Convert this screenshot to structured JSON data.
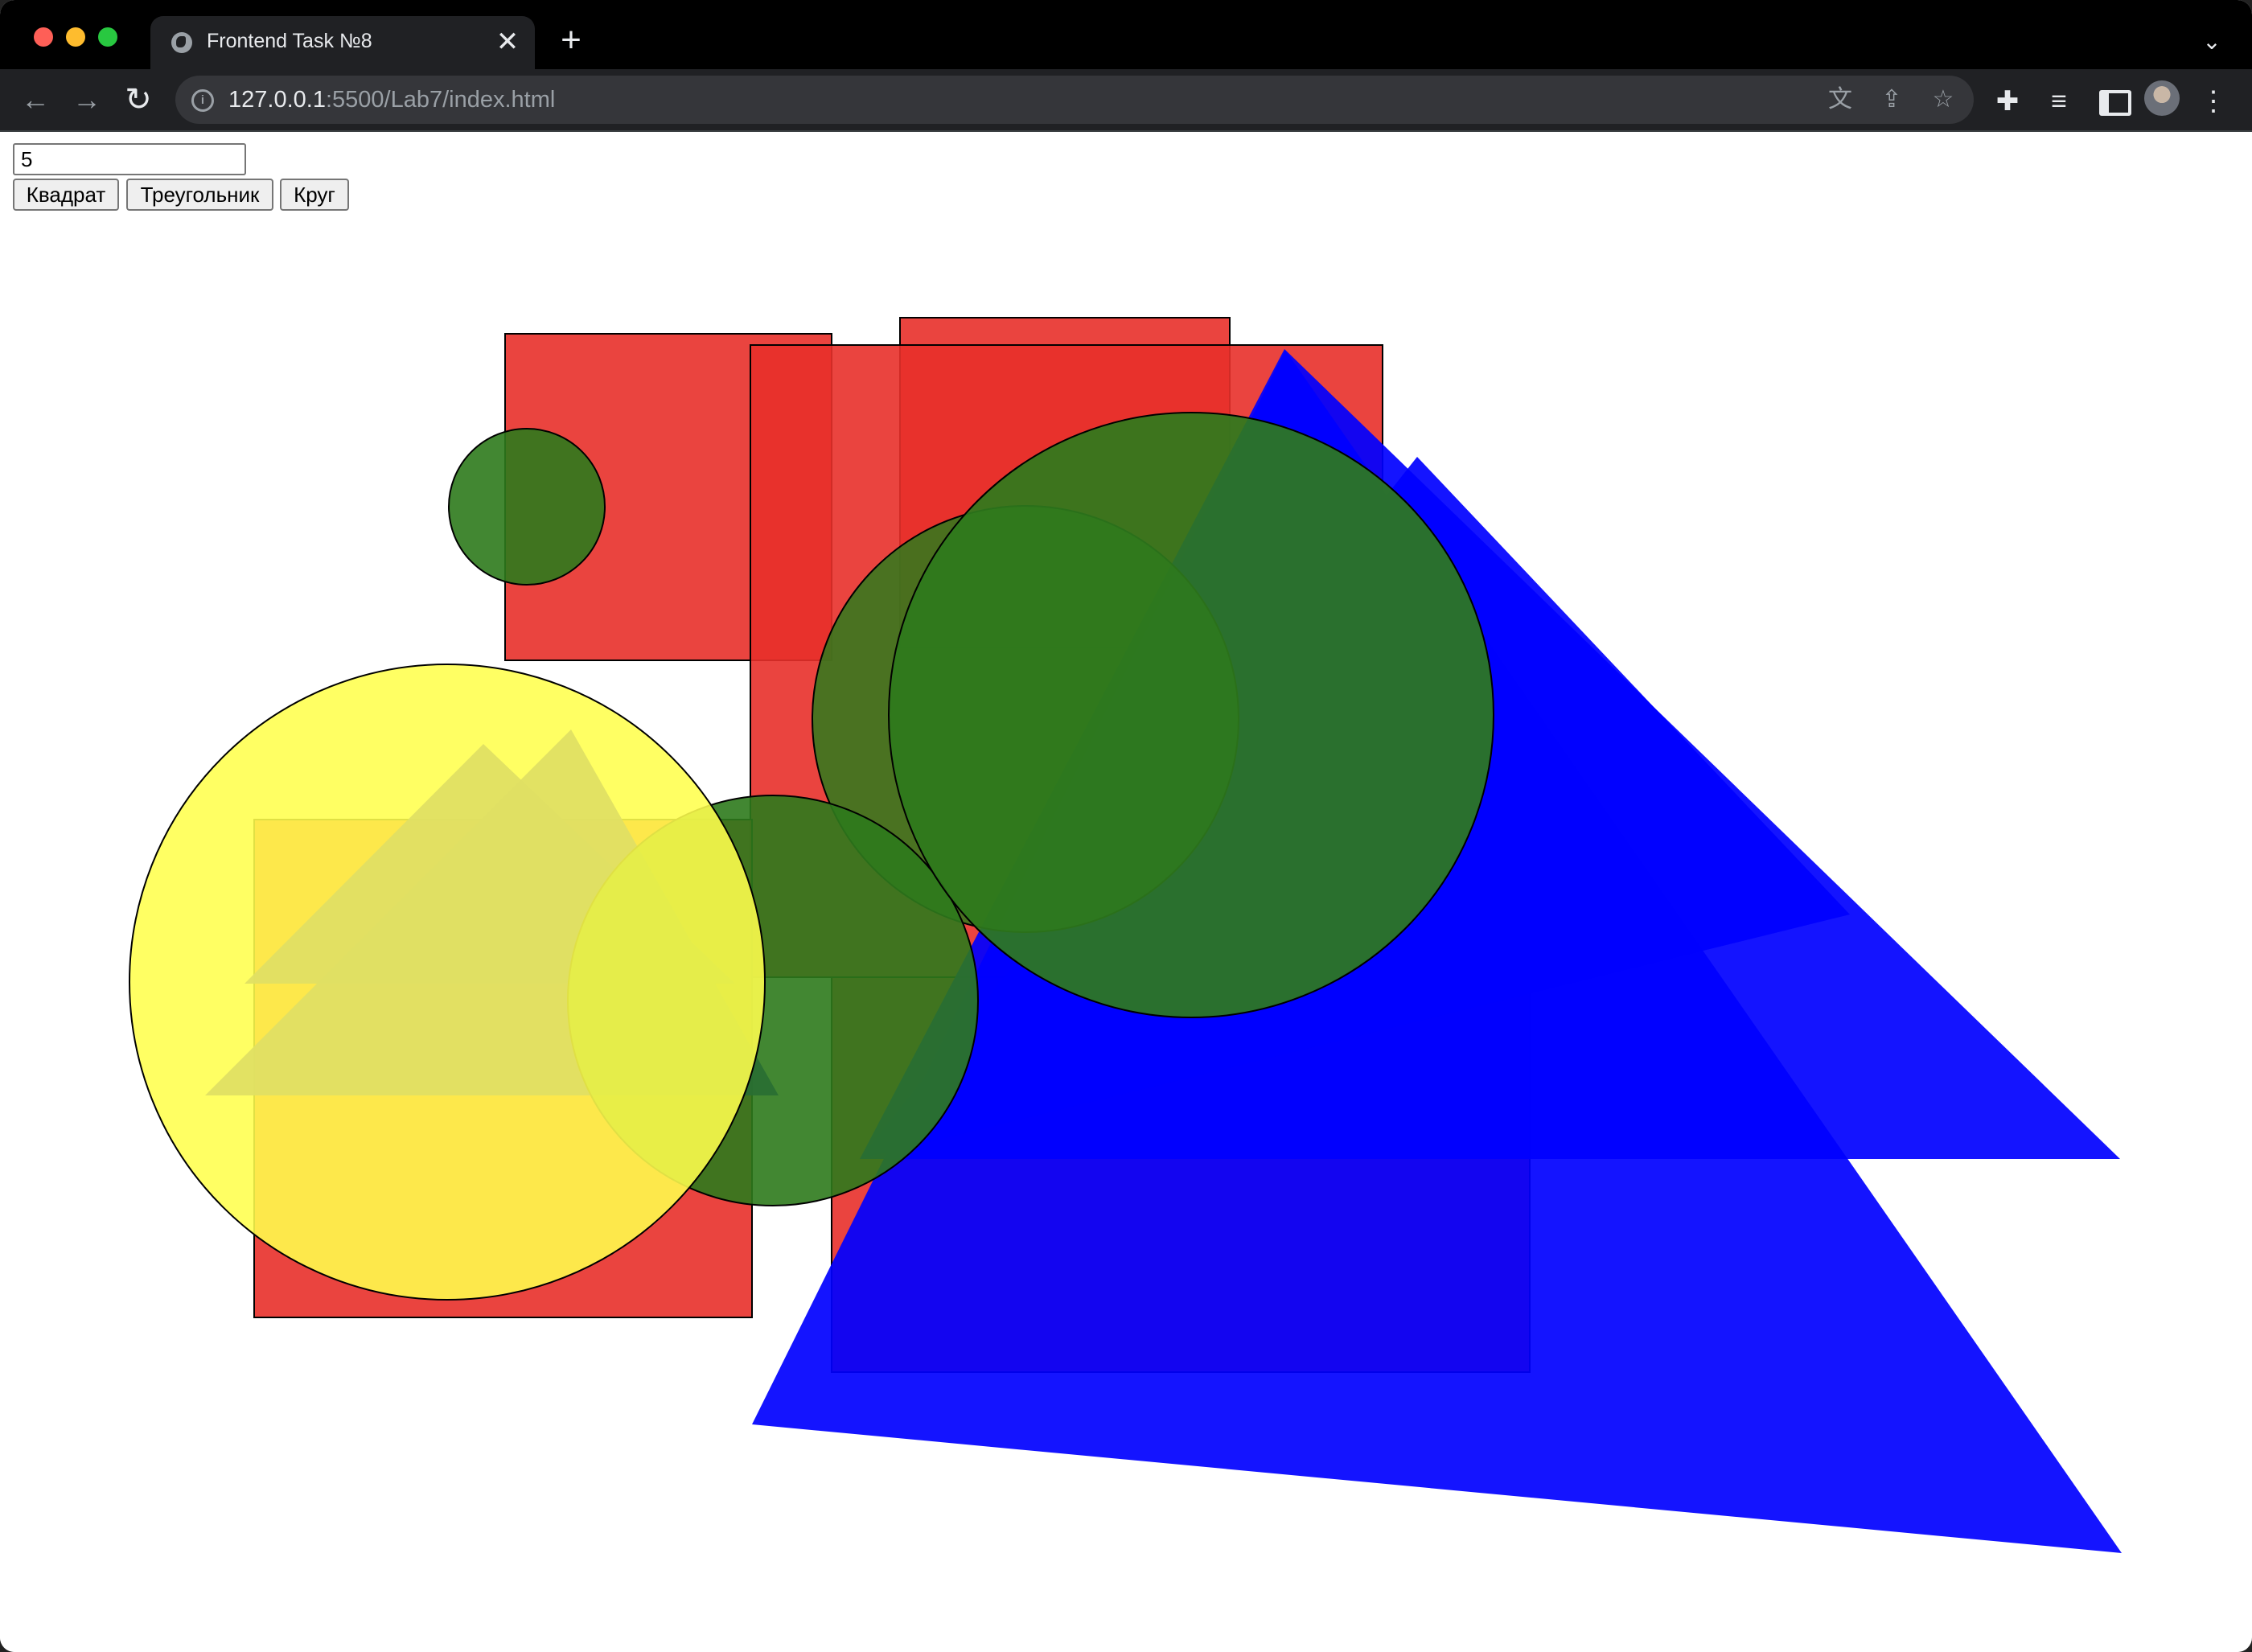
{
  "browser": {
    "tab_title": "Frontend Task №8",
    "tab_close_glyph": "✕",
    "new_tab_glyph": "+",
    "tab_search_glyph": "⌄",
    "url_host": "127.0.0.1",
    "url_rest": ":5500/Lab7/index.html",
    "site_info_glyph": "i",
    "back_glyph": "←",
    "forward_glyph": "→",
    "reload_glyph": "↻",
    "translate_glyph": "文",
    "share_glyph": "⇪",
    "bookmark_glyph": "☆",
    "extensions_glyph": "✚",
    "media_glyph": "≡",
    "menu_glyph": "⋮"
  },
  "form": {
    "count_value": "5",
    "buttons": {
      "square": "Квадрат",
      "triangle": "Треугольник",
      "circle": "Круг"
    }
  },
  "colors": {
    "square": "#e8302a",
    "triangle": "#0000ff",
    "circle_green": "#2e7a1c",
    "circle_yellow": "#ffff4d"
  }
}
